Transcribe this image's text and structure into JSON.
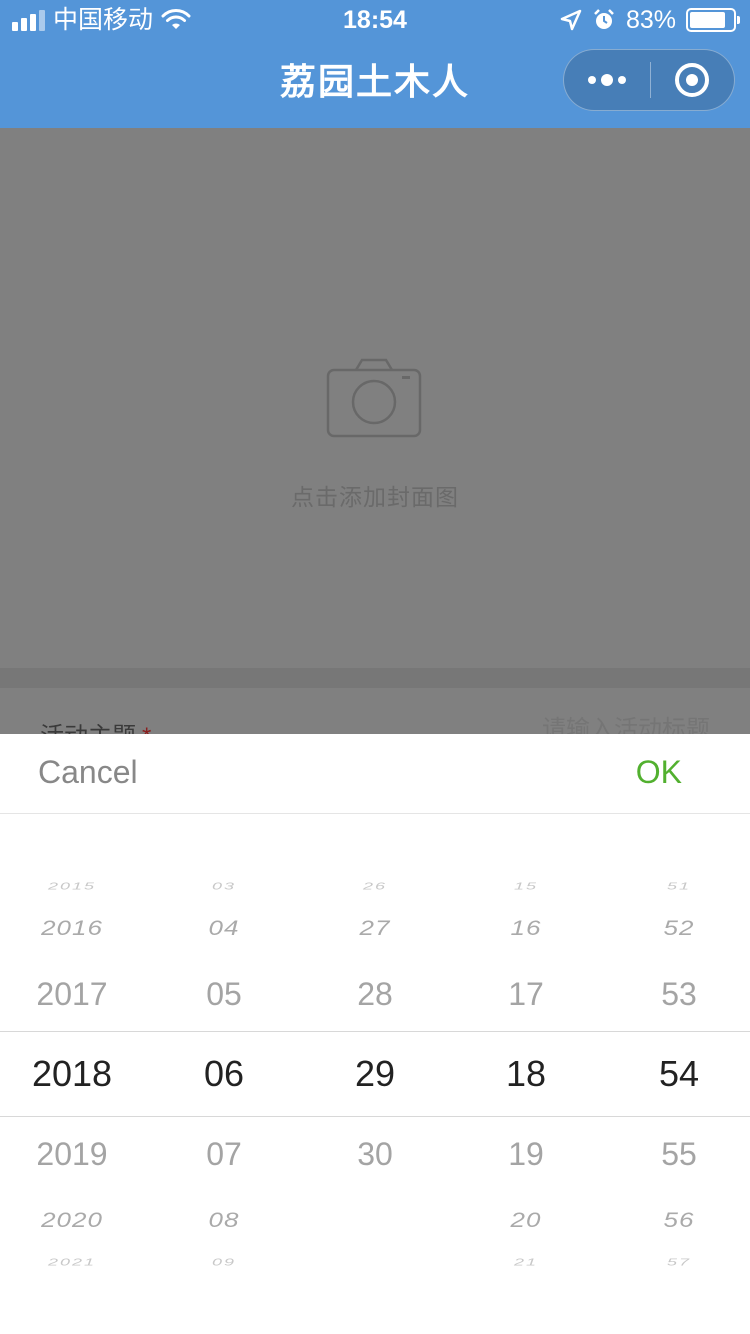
{
  "status_bar": {
    "carrier": "中国移动",
    "time": "18:54",
    "battery": "83%",
    "battery_level": 0.83
  },
  "nav": {
    "title": "荔园土木人"
  },
  "cover": {
    "add_cover_text": "点击添加封面图"
  },
  "form": {
    "title_label": "活动主题",
    "required_mark": "*",
    "title_placeholder": "请输入活动标题"
  },
  "picker": {
    "cancel_label": "Cancel",
    "ok_label": "OK",
    "columns": [
      {
        "name": "year",
        "items": [
          "2015",
          "2016",
          "2017",
          "2018",
          "2019",
          "2020",
          "2021"
        ],
        "selected": "2018"
      },
      {
        "name": "month",
        "items": [
          "03",
          "04",
          "05",
          "06",
          "07",
          "08",
          "09"
        ],
        "selected": "06"
      },
      {
        "name": "day",
        "items": [
          "26",
          "27",
          "28",
          "29",
          "30"
        ],
        "selected": "29"
      },
      {
        "name": "hour",
        "items": [
          "15",
          "16",
          "17",
          "18",
          "19",
          "20",
          "21"
        ],
        "selected": "18"
      },
      {
        "name": "minute",
        "items": [
          "51",
          "52",
          "53",
          "54",
          "55",
          "56",
          "57"
        ],
        "selected": "54"
      }
    ]
  },
  "colors": {
    "nav_background": "#5495d8",
    "ok_green": "#52b02f",
    "overlay_gray": "#7f7f7f"
  }
}
